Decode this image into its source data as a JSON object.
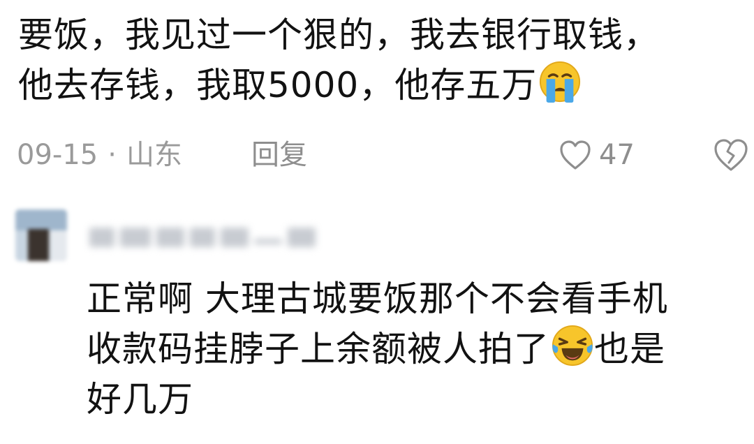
{
  "comment": {
    "text_line1": "要饭，我见过一个狠的，我去银行取钱，",
    "text_line2": "他去存钱，我取5000，他存五万",
    "emoji": "crying-face",
    "date": "09-15",
    "separator": "·",
    "location": "山东",
    "reply_label": "回复",
    "like_count": "47"
  },
  "reply": {
    "username": "",
    "text_line1": "正常啊 大理古城要饭那个不会看手机",
    "text_line2": "收款码挂脖子上余额被人拍了",
    "emoji": "laughing-tears-face",
    "text_line2_after": "也是",
    "text_line3": "好几万"
  },
  "colors": {
    "text": "#121212",
    "meta": "#9a9a9a",
    "emoji_face": "#f7c52b",
    "emoji_tear": "#4aa8e8"
  }
}
